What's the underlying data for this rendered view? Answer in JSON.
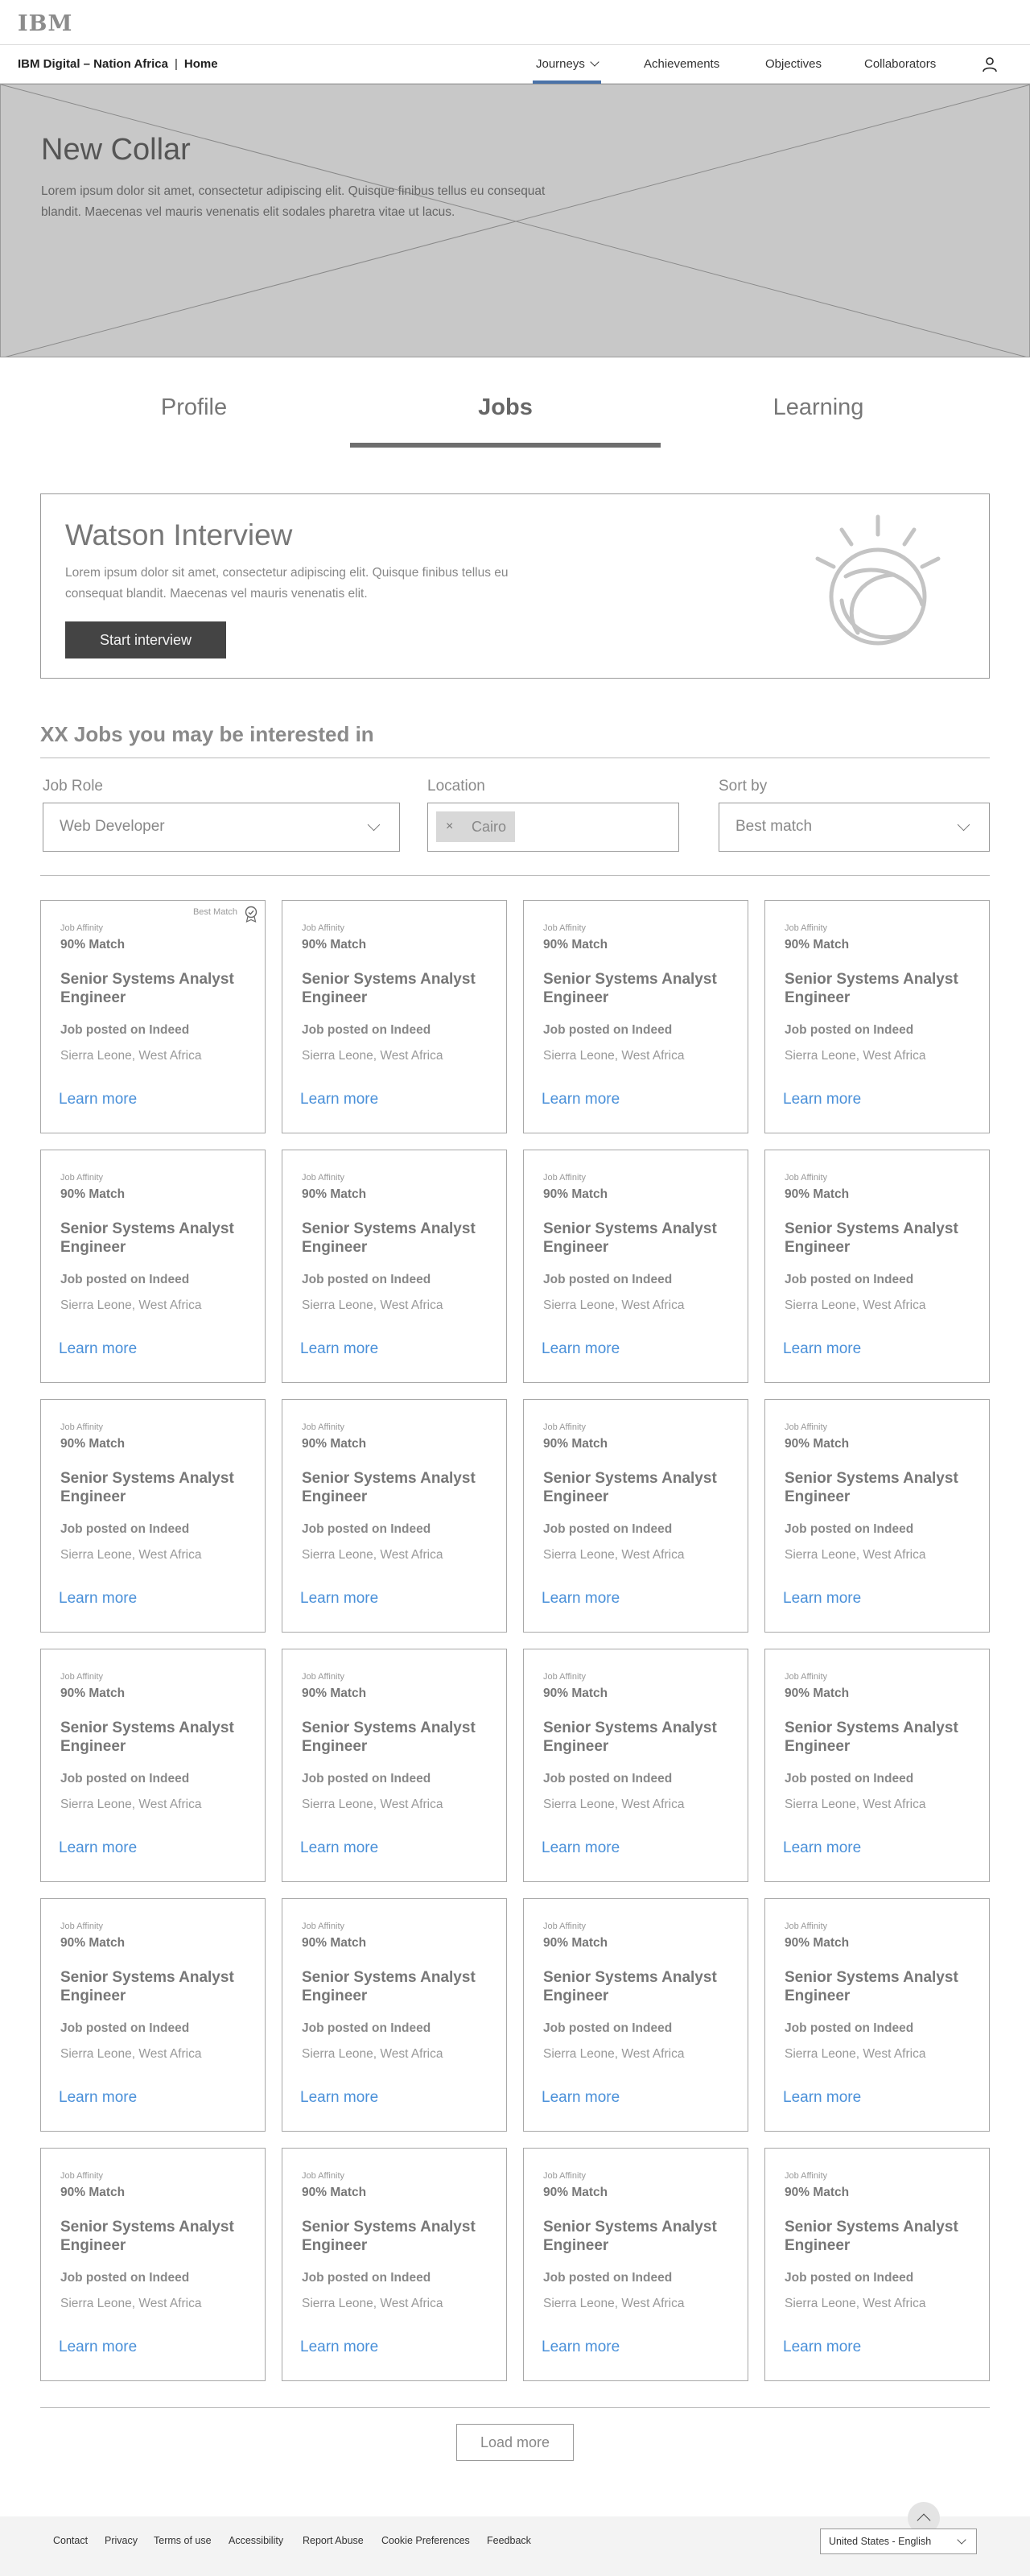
{
  "brand": {
    "logo_text": "IBM"
  },
  "navbar": {
    "org": "IBM Digital – Nation Africa",
    "separator": "|",
    "home": "Home",
    "links": [
      {
        "label": "Journeys",
        "active": true,
        "has_dropdown": true
      },
      {
        "label": "Achievements"
      },
      {
        "label": "Objectives"
      },
      {
        "label": "Collaborators"
      }
    ],
    "user_icon": "user-icon"
  },
  "hero": {
    "title": "New Collar",
    "text": "Lorem ipsum dolor sit amet, consectetur adipiscing elit. Quisque finibus tellus eu consequat blandit. Maecenas vel mauris venenatis elit sodales pharetra vitae ut lacus."
  },
  "tabs": [
    {
      "label": "Profile"
    },
    {
      "label": "Jobs",
      "active": true
    },
    {
      "label": "Learning"
    }
  ],
  "watson": {
    "title": "Watson Interview",
    "text": "Lorem ipsum dolor sit amet, consectetur adipiscing elit. Quisque finibus tellus eu consequat blandit. Maecenas vel mauris venenatis elit.",
    "button": "Start interview",
    "logo_icon": "watson-logo-icon"
  },
  "jobs": {
    "heading": "XX Jobs you may be interested in",
    "filters": {
      "role_label": "Job Role",
      "role_value": "Web Developer",
      "location_label": "Location",
      "location_tag": "Cairo",
      "location_tag_remove": "×",
      "sort_label": "Sort by",
      "sort_value": "Best match"
    },
    "best_match_label": "Best Match",
    "card": {
      "affinity_label": "Job Affinity",
      "match": "90% Match",
      "title": "Senior Systems Analyst Engineer",
      "posted": "Job posted on Indeed",
      "location": "Sierra Leone, West Africa",
      "link": "Learn more"
    },
    "card_count": 24,
    "load_more": "Load more"
  },
  "footer": {
    "links": [
      "Contact",
      "Privacy",
      "Terms of use",
      "Accessibility",
      "Report Abuse",
      "Cookie Preferences",
      "Feedback"
    ],
    "language": "United States - English",
    "back_to_top_icon": "chevron-up-icon"
  },
  "colors": {
    "link_blue": "#4a90d9",
    "nav_active": "#4a72a8",
    "hero_gray": "#c8c8c8",
    "button_dark": "#444444"
  }
}
